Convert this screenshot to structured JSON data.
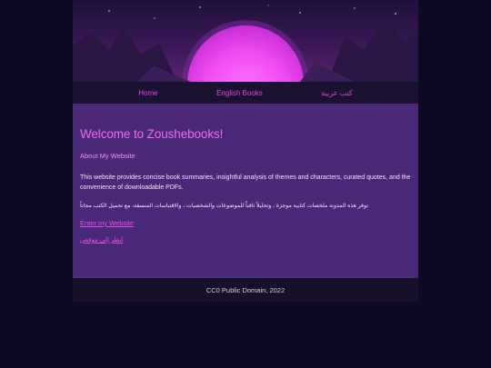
{
  "nav": {
    "items": [
      {
        "label": "Home"
      },
      {
        "label": "English Books"
      },
      {
        "label": "كتب عربية"
      }
    ]
  },
  "main": {
    "title": "Welcome to Zoushebooks!",
    "subtitle": "About My Website",
    "description_en": "This website provides concise book summaries, insightful analysis of themes and characters, curated quotes, and the convenience of downloadable PDFs.",
    "description_ar": "توفر هذه المدونة ملخصات كتابية موجزة ، وتحليلاً ثاقباً للموضوعات والشخصيات ، والاقتباسات المنسقة، مع تحميل الكتب مجاناً",
    "enter_link": "Enter my Website",
    "enter_link_ar": "انظر إلى موقعي"
  },
  "footer": {
    "text": "CC0 Public Domain, 2022"
  },
  "colors": {
    "accent": "#e23fe8",
    "heading": "#ee6af0",
    "panel": "#4a2a78",
    "nav_bg": "#1b1232",
    "page_bg": "#0f0a24"
  }
}
